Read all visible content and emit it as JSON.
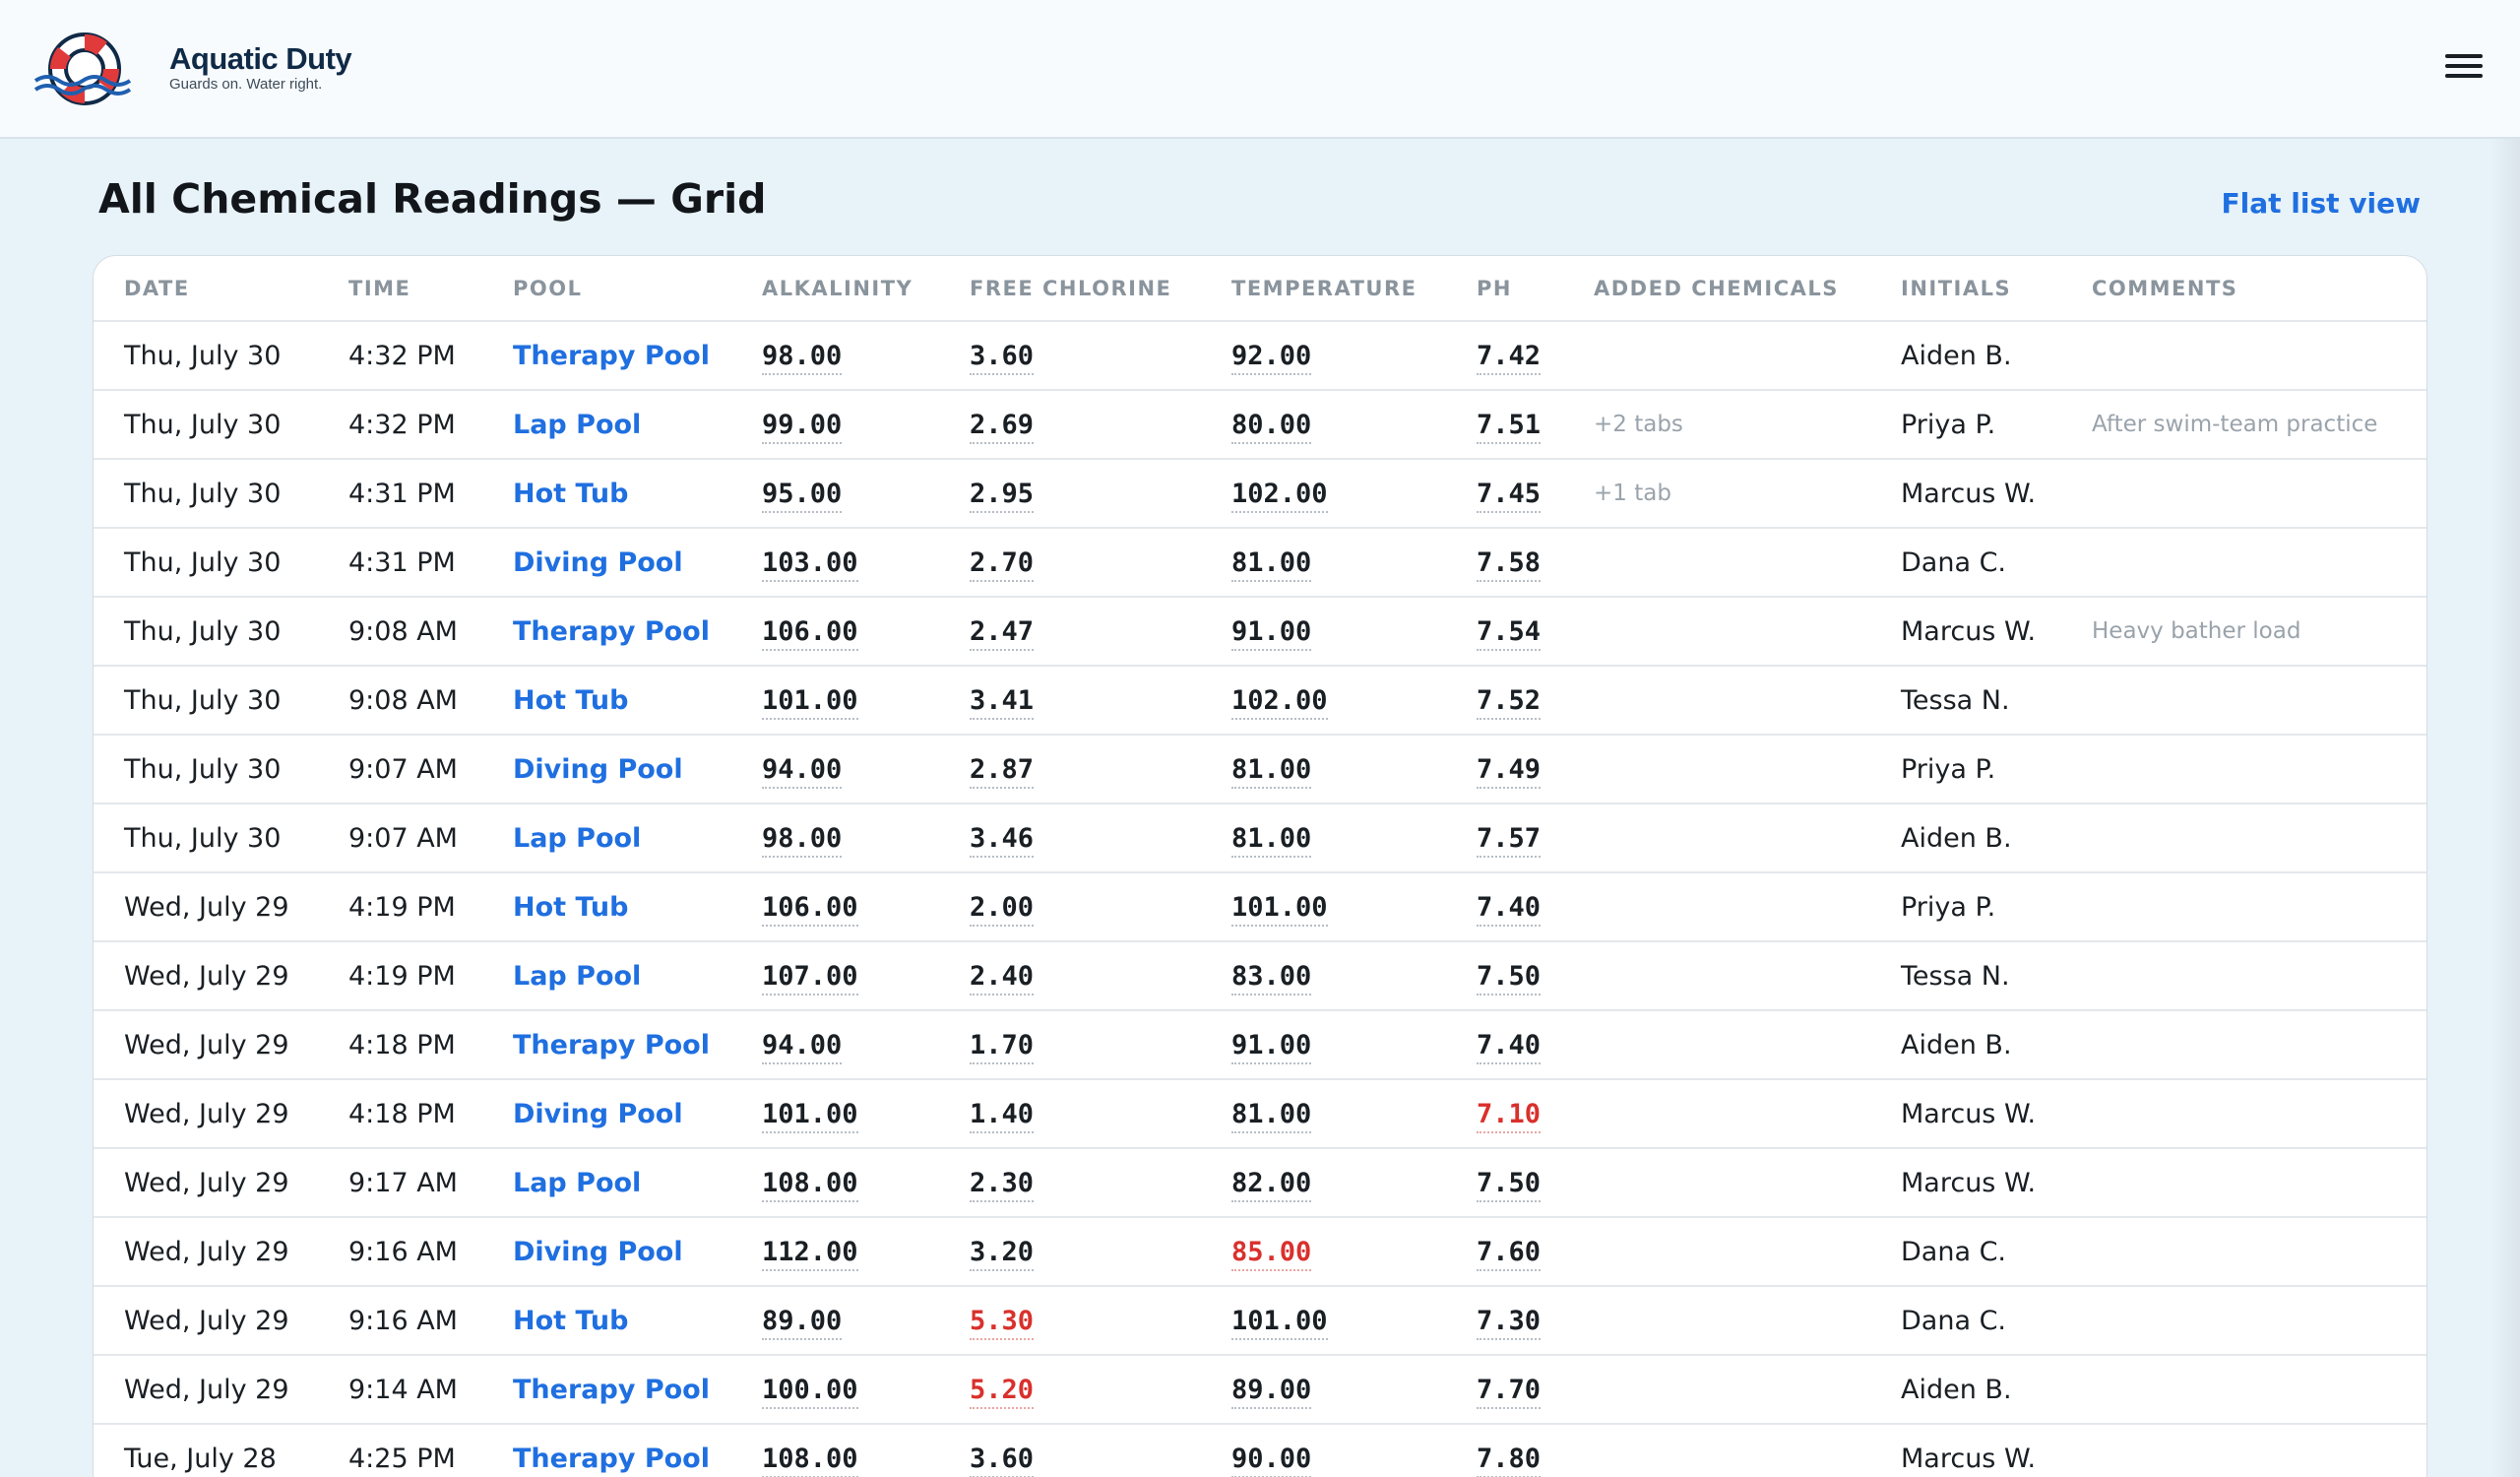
{
  "brand": {
    "name": "Aquatic Duty",
    "tagline": "Guards on. Water right."
  },
  "page": {
    "title": "All Chemical Readings — Grid",
    "flat_link": "Flat list view"
  },
  "table": {
    "headers": [
      "DATE",
      "TIME",
      "POOL",
      "ALKALINITY",
      "FREE CHLORINE",
      "TEMPERATURE",
      "PH",
      "ADDED CHEMICALS",
      "INITIALS",
      "COMMENTS"
    ],
    "rows": [
      {
        "date": "Thu, July 30",
        "time": "4:32 PM",
        "pool": "Therapy Pool",
        "alkalinity": "98.00",
        "chlorine": "3.60",
        "temperature": "92.00",
        "ph": "7.42",
        "added": "",
        "initials": "Aiden B.",
        "comments": "",
        "warn": []
      },
      {
        "date": "Thu, July 30",
        "time": "4:32 PM",
        "pool": "Lap Pool",
        "alkalinity": "99.00",
        "chlorine": "2.69",
        "temperature": "80.00",
        "ph": "7.51",
        "added": "+2 tabs",
        "initials": "Priya P.",
        "comments": "After swim-team practice",
        "warn": []
      },
      {
        "date": "Thu, July 30",
        "time": "4:31 PM",
        "pool": "Hot Tub",
        "alkalinity": "95.00",
        "chlorine": "2.95",
        "temperature": "102.00",
        "ph": "7.45",
        "added": "+1 tab",
        "initials": "Marcus W.",
        "comments": "",
        "warn": []
      },
      {
        "date": "Thu, July 30",
        "time": "4:31 PM",
        "pool": "Diving Pool",
        "alkalinity": "103.00",
        "chlorine": "2.70",
        "temperature": "81.00",
        "ph": "7.58",
        "added": "",
        "initials": "Dana C.",
        "comments": "",
        "warn": []
      },
      {
        "date": "Thu, July 30",
        "time": "9:08 AM",
        "pool": "Therapy Pool",
        "alkalinity": "106.00",
        "chlorine": "2.47",
        "temperature": "91.00",
        "ph": "7.54",
        "added": "",
        "initials": "Marcus W.",
        "comments": "Heavy bather load",
        "warn": []
      },
      {
        "date": "Thu, July 30",
        "time": "9:08 AM",
        "pool": "Hot Tub",
        "alkalinity": "101.00",
        "chlorine": "3.41",
        "temperature": "102.00",
        "ph": "7.52",
        "added": "",
        "initials": "Tessa N.",
        "comments": "",
        "warn": []
      },
      {
        "date": "Thu, July 30",
        "time": "9:07 AM",
        "pool": "Diving Pool",
        "alkalinity": "94.00",
        "chlorine": "2.87",
        "temperature": "81.00",
        "ph": "7.49",
        "added": "",
        "initials": "Priya P.",
        "comments": "",
        "warn": []
      },
      {
        "date": "Thu, July 30",
        "time": "9:07 AM",
        "pool": "Lap Pool",
        "alkalinity": "98.00",
        "chlorine": "3.46",
        "temperature": "81.00",
        "ph": "7.57",
        "added": "",
        "initials": "Aiden B.",
        "comments": "",
        "warn": []
      },
      {
        "date": "Wed, July 29",
        "time": "4:19 PM",
        "pool": "Hot Tub",
        "alkalinity": "106.00",
        "chlorine": "2.00",
        "temperature": "101.00",
        "ph": "7.40",
        "added": "",
        "initials": "Priya P.",
        "comments": "",
        "warn": []
      },
      {
        "date": "Wed, July 29",
        "time": "4:19 PM",
        "pool": "Lap Pool",
        "alkalinity": "107.00",
        "chlorine": "2.40",
        "temperature": "83.00",
        "ph": "7.50",
        "added": "",
        "initials": "Tessa N.",
        "comments": "",
        "warn": []
      },
      {
        "date": "Wed, July 29",
        "time": "4:18 PM",
        "pool": "Therapy Pool",
        "alkalinity": "94.00",
        "chlorine": "1.70",
        "temperature": "91.00",
        "ph": "7.40",
        "added": "",
        "initials": "Aiden B.",
        "comments": "",
        "warn": []
      },
      {
        "date": "Wed, July 29",
        "time": "4:18 PM",
        "pool": "Diving Pool",
        "alkalinity": "101.00",
        "chlorine": "1.40",
        "temperature": "81.00",
        "ph": "7.10",
        "added": "",
        "initials": "Marcus W.",
        "comments": "",
        "warn": [
          "ph"
        ]
      },
      {
        "date": "Wed, July 29",
        "time": "9:17 AM",
        "pool": "Lap Pool",
        "alkalinity": "108.00",
        "chlorine": "2.30",
        "temperature": "82.00",
        "ph": "7.50",
        "added": "",
        "initials": "Marcus W.",
        "comments": "",
        "warn": []
      },
      {
        "date": "Wed, July 29",
        "time": "9:16 AM",
        "pool": "Diving Pool",
        "alkalinity": "112.00",
        "chlorine": "3.20",
        "temperature": "85.00",
        "ph": "7.60",
        "added": "",
        "initials": "Dana C.",
        "comments": "",
        "warn": [
          "temperature"
        ]
      },
      {
        "date": "Wed, July 29",
        "time": "9:16 AM",
        "pool": "Hot Tub",
        "alkalinity": "89.00",
        "chlorine": "5.30",
        "temperature": "101.00",
        "ph": "7.30",
        "added": "",
        "initials": "Dana C.",
        "comments": "",
        "warn": [
          "chlorine"
        ]
      },
      {
        "date": "Wed, July 29",
        "time": "9:14 AM",
        "pool": "Therapy Pool",
        "alkalinity": "100.00",
        "chlorine": "5.20",
        "temperature": "89.00",
        "ph": "7.70",
        "added": "",
        "initials": "Aiden B.",
        "comments": "",
        "warn": [
          "chlorine"
        ]
      },
      {
        "date": "Tue, July 28",
        "time": "4:25 PM",
        "pool": "Therapy Pool",
        "alkalinity": "108.00",
        "chlorine": "3.60",
        "temperature": "90.00",
        "ph": "7.80",
        "added": "",
        "initials": "Marcus W.",
        "comments": "",
        "warn": []
      }
    ]
  },
  "colors": {
    "accent": "#1f6fe0",
    "warning": "#d9302c",
    "brand_navy": "#0f2a47",
    "buoy_red": "#e03a3a"
  },
  "icons": {
    "logo": "life-ring-icon",
    "menu": "hamburger-menu-icon"
  }
}
